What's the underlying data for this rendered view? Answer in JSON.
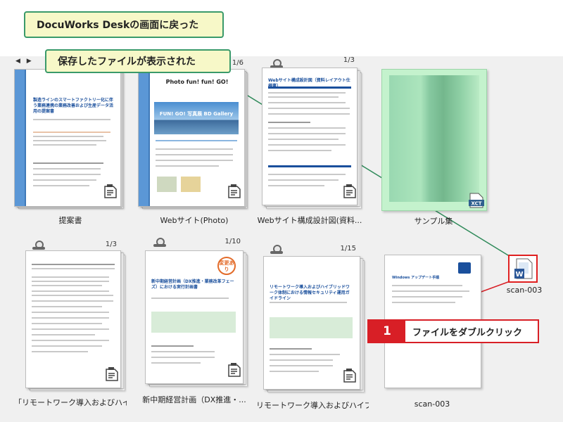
{
  "callouts": {
    "title": "DocuWorks Deskの画面に戻った",
    "saved": "保存したファイルが表示された",
    "step_number": "1",
    "step_text": "ファイルをダブルクリック"
  },
  "nav_arrows": "◀ ▶",
  "items": [
    {
      "label": "提案書",
      "page": "",
      "heading": "製造ラインのスマートファクトリー化に伴う業務連携の業務改善および生産データ活用の提案書"
    },
    {
      "label": "Webサイト(Photo)",
      "page": "1/6",
      "heading": "Photo fun! fun! GO!",
      "banner": "FUN! GO! 写真展 BD Gallery"
    },
    {
      "label": "Webサイト構成設計図(資料...",
      "page": "1/3",
      "heading": "Webサイト構成設計図（資料レイアウト仕様書）"
    },
    {
      "label": "サンプル集",
      "page": "",
      "badge": "XCT"
    },
    {
      "label": "「リモートワーク導入およびハイ...",
      "page": "1/3",
      "heading": ""
    },
    {
      "label": "新中期経営計画（DX推進・...",
      "page": "1/10",
      "heading": "新中期経営計画（DX推進・業務改革フェーズ）における実行計画書",
      "stamp": "変更あり"
    },
    {
      "label": "リモートワーク導入およびハイブ...",
      "page": "1/15",
      "heading": "リモートワーク導入およびハイブリッドワーク体制における情報セキュリティ運用ガイドライン"
    },
    {
      "label": "scan-003",
      "page": "",
      "heading": "Windows アップデート手順"
    },
    {
      "label": "scan-003",
      "page": ""
    }
  ],
  "colors": {
    "callout_border": "#3a9a6a",
    "callout_bg": "#f7f8c8",
    "step_red": "#d81f26",
    "binder_blue": "#5b97d6"
  }
}
